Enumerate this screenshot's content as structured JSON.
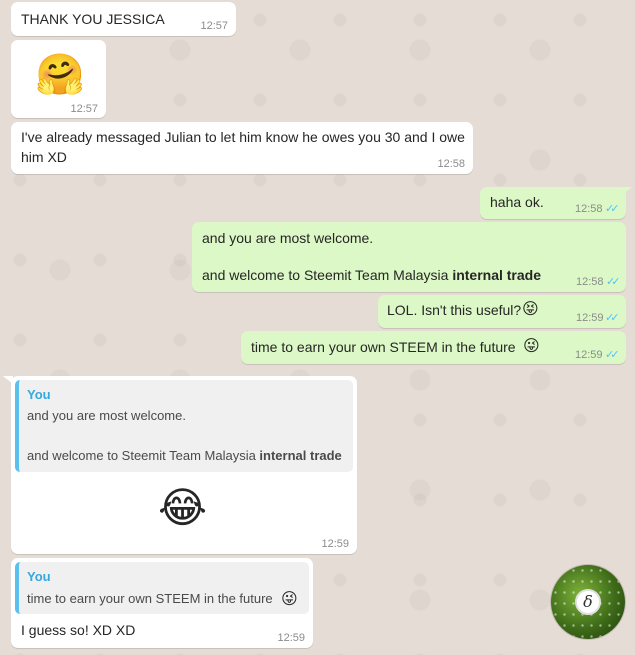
{
  "messages": {
    "m1": {
      "text": "THANK YOU JESSICA",
      "time": "12:57"
    },
    "m2": {
      "emoji": "🤗",
      "time": "12:57"
    },
    "m3": {
      "line1": "I've already messaged Julian to let him know he owes you 30 and I owe",
      "line2": "him XD",
      "time": "12:58"
    },
    "m4": {
      "text": "haha ok.",
      "time": "12:58",
      "ticks": "✓✓"
    },
    "m5": {
      "line1": "and you are most welcome.",
      "line2_pre": "and welcome to Steemit Team Malaysia ",
      "line2_bold": "internal trade",
      "time": "12:58",
      "ticks": "✓✓"
    },
    "m6": {
      "text": "LOL. Isn't this useful?",
      "emoji": "😝",
      "time": "12:59",
      "ticks": "✓✓"
    },
    "m7": {
      "text": "time to earn your own STEEM in the future",
      "emoji": "😜",
      "time": "12:59",
      "ticks": "✓✓"
    },
    "m8": {
      "quote_name": "You",
      "quote_line1": "and you are most welcome.",
      "quote_line2_pre": "and welcome to Steemit Team Malaysia ",
      "quote_line2_bold": "internal trade",
      "emoji": "😂",
      "time": "12:59"
    },
    "m9": {
      "quote_name": "You",
      "quote_text": "time to earn your own STEEM in the future",
      "quote_emoji": "😜",
      "text": "I guess so! XD XD",
      "time": "12:59"
    }
  },
  "avatar": {
    "glyph": "δ"
  },
  "colors": {
    "incoming": "#ffffff",
    "outgoing": "#dcf8c6",
    "read_ticks": "#4fc3f7",
    "quote_bar": "#5bc0eb"
  }
}
